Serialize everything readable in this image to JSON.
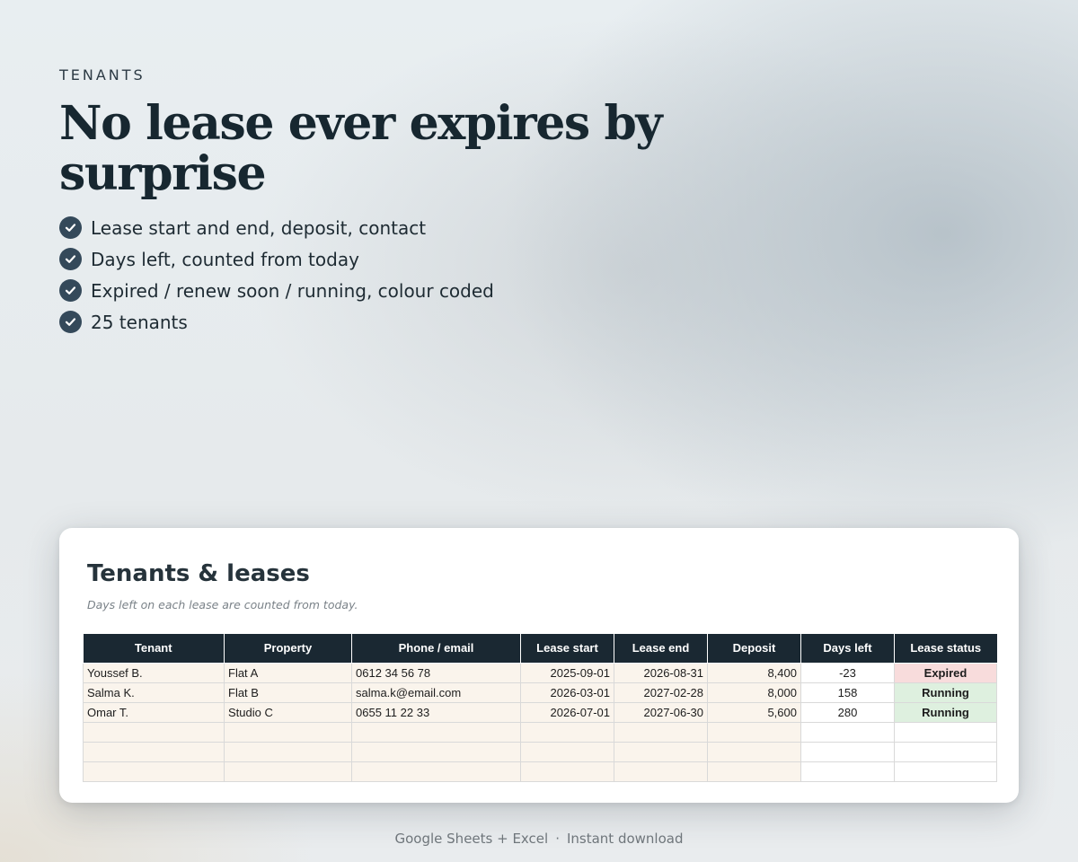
{
  "hero": {
    "eyebrow": "TENANTS",
    "headline": "No lease ever expires by surprise",
    "features": [
      "Lease start and end, deposit, contact",
      "Days left, counted from today",
      "Expired / renew soon / running, colour coded",
      "25 tenants"
    ]
  },
  "sheet": {
    "title": "Tenants & leases",
    "subtitle": "Days left on each lease are counted from today.",
    "columns": [
      "Tenant",
      "Property",
      "Phone / email",
      "Lease start",
      "Lease end",
      "Deposit",
      "Days left",
      "Lease status"
    ],
    "rows": [
      {
        "tenant": "Youssef B.",
        "property": "Flat A",
        "contact": "0612 34 56 78",
        "start": "2025-09-01",
        "end": "2026-08-31",
        "deposit": "8,400",
        "days_left": "-23",
        "status": "Expired"
      },
      {
        "tenant": "Salma K.",
        "property": "Flat B",
        "contact": "salma.k@email.com",
        "start": "2026-03-01",
        "end": "2027-02-28",
        "deposit": "8,000",
        "days_left": "158",
        "status": "Running"
      },
      {
        "tenant": "Omar T.",
        "property": "Studio C",
        "contact": "0655 11 22 33",
        "start": "2026-07-01",
        "end": "2027-06-30",
        "deposit": "5,600",
        "days_left": "280",
        "status": "Running"
      }
    ]
  },
  "footer": {
    "platforms": "Google Sheets + Excel",
    "separator": "·",
    "delivery": "Instant download"
  },
  "colors": {
    "header_bg": "#1a2832",
    "input_cell_bg": "#faf4ec",
    "expired_bg": "#f8dcdc",
    "running_bg": "#def0df",
    "check_icon_bg": "#34495a"
  }
}
